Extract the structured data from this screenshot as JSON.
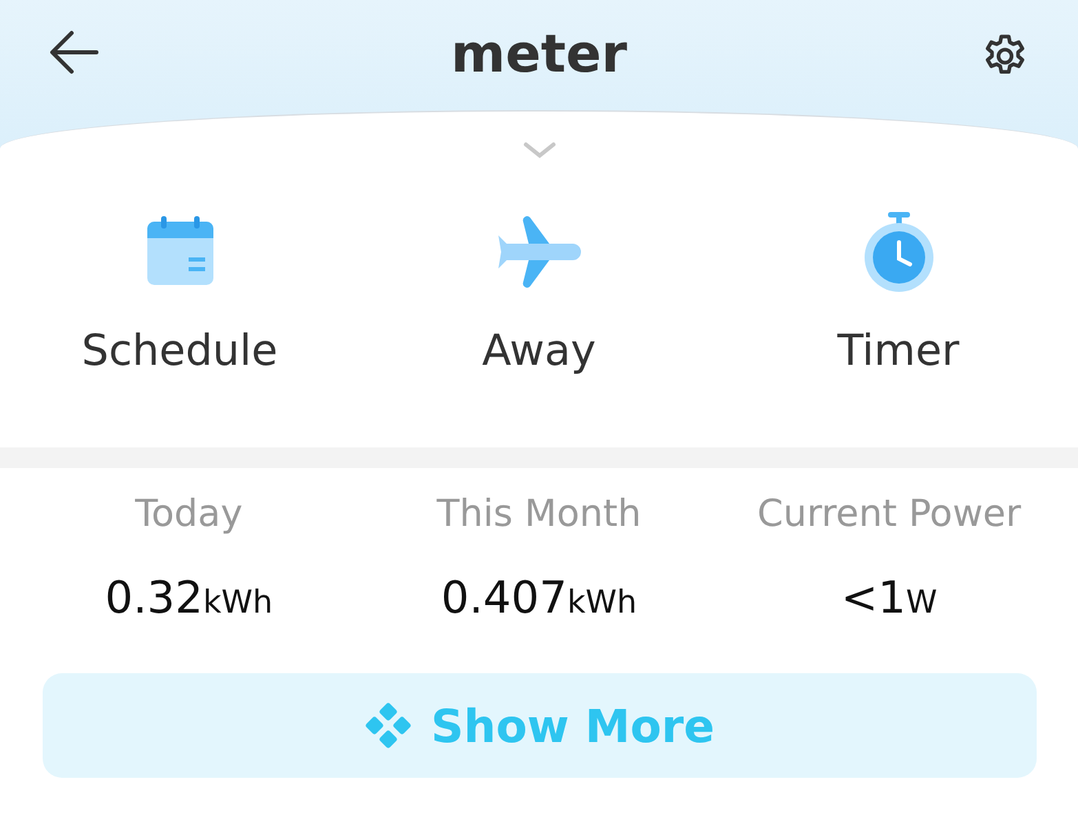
{
  "header": {
    "title": "meter"
  },
  "actions": [
    {
      "kind": "calendar",
      "label": "Schedule"
    },
    {
      "kind": "plane",
      "label": "Away"
    },
    {
      "kind": "stopwatch",
      "label": "Timer"
    }
  ],
  "stats": [
    {
      "label": "Today",
      "value": "0.32",
      "unit": "kWh"
    },
    {
      "label": "This Month",
      "value": "0.407",
      "unit": "kWh"
    },
    {
      "label": "Current Power",
      "value": "<1",
      "unit": "W"
    }
  ],
  "more_button": {
    "label": "Show More"
  }
}
